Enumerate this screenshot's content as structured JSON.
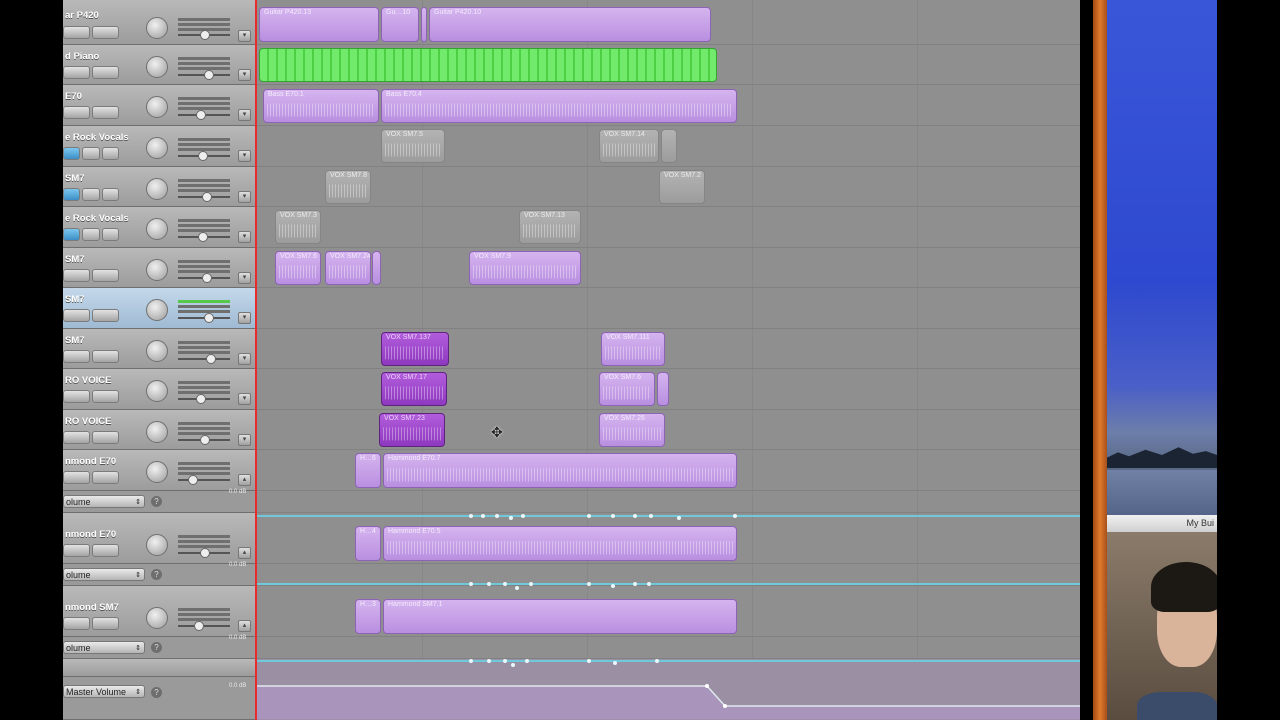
{
  "tracks": [
    {
      "name": "ar P420"
    },
    {
      "name": "d Piano"
    },
    {
      "name": "E70"
    },
    {
      "name": "e Rock Vocals"
    },
    {
      "name": "SM7"
    },
    {
      "name": "e Rock Vocals"
    },
    {
      "name": "SM7"
    },
    {
      "name": "SM7",
      "selected": true
    },
    {
      "name": "SM7"
    },
    {
      "name": "RO VOICE"
    },
    {
      "name": "RO VOICE"
    },
    {
      "name": "nmond E70"
    },
    {
      "name": "nmond E70"
    },
    {
      "name": "nmond SM7"
    }
  ],
  "automation": [
    {
      "param": "olume",
      "db": "0.0 dB"
    },
    {
      "param": "olume",
      "db": "0.0 dB"
    },
    {
      "param": "olume",
      "db": "0.0 dB"
    },
    {
      "param": "Master Volume",
      "db": "0.0 dB"
    }
  ],
  "regions": {
    "r0a": "Guitar P420.13",
    "r0b": "Gu…10",
    "r0c": "Guitar P420.10",
    "r2a": "Bass E70.1",
    "r2b": "Bass E70.4",
    "r3a": "VOX SM7.5",
    "r3b": "VOX SM7.14",
    "r4a": "VOX SM7.8",
    "r4b": "VOX SM7.2",
    "r5a": "VOX SM7.3",
    "r5b": "VOX SM7.13",
    "r6a": "VOX SM7.6",
    "r6b": "VOX SM7.24",
    "r6c": "VOX SM7.9",
    "r8a": "VOX SM7.137",
    "r8b": "VOX SM7.111",
    "r9a": "VOX SM7.17",
    "r9b": "VOX SM7.6",
    "r10a": "VOX SM7.23",
    "r10b": "VOX SM7.26",
    "r11a": "H…6",
    "r11b": "Hammond E70.7",
    "r12a": "H…4",
    "r12b": "Hammond E70.5",
    "r13a": "H…3",
    "r13b": "Hammond SM7.1"
  },
  "webcam": {
    "title": "My Bui"
  },
  "colors": {
    "playhead": "#e82b2b",
    "region_purple": "#c7a1ea",
    "region_dark_purple": "#9d45cc",
    "region_gray": "#a8a8a8",
    "region_green": "#5fe05a",
    "automation_line": "#6fc9da"
  }
}
